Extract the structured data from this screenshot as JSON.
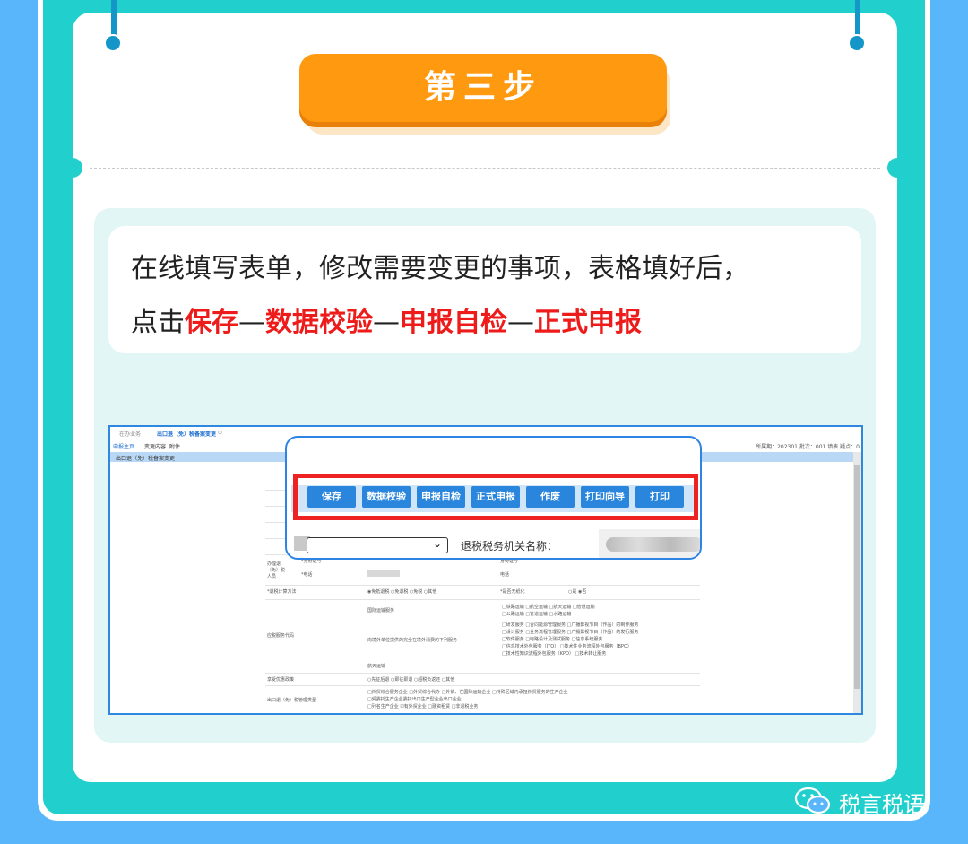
{
  "step_title": "第三步",
  "instruction": {
    "line1": "在线填写表单，修改需要变更的事项，表格填好后，",
    "prefix": "点击",
    "step1": "保存",
    "sep1": "—",
    "step2": "数据校验",
    "sep2": "—",
    "step3": "申报自检",
    "sep3": "—",
    "step4": "正式申报"
  },
  "screenshot": {
    "top_tabs": [
      "在办业务",
      "出口退（免）税备案变更",
      "⊙"
    ],
    "subtabs": [
      "申报主页",
      "变更内容",
      "附件"
    ],
    "header_info": "所属期：202301  批次：001  填表  疑点：0",
    "section_title": "出口退（免）税备案变更",
    "form_labels": {
      "agent": "办理退（免）税人员",
      "id_no": "*身份证号",
      "id_no2": "身份证号",
      "phone": "*电话",
      "phone2": "电话",
      "calc_method": "*退税计算方法",
      "calc_options": "◉免抵退税  ○免退税  ○免税  ○其他",
      "paperless": "*是否无纸化",
      "paperless_options": "○是  ◉否",
      "zero_rate_service": "应税服务代码",
      "international_transport": "国际运输服务",
      "foreign_service": "向境外单位提供的完全在境外消费的下列服务",
      "other_service": "航天运输",
      "tax_policy": "享受优惠政策",
      "tax_policy_options": "○先征后退  ○即征即退  ○超税负返还  ○其他",
      "mgmt_type": "出口退（免）税管理类型"
    },
    "service_options": [
      "□铁路运输  □航空运输  □航天运输  □管道运输",
      "□公路运输  □管道运输  □水路运输",
      "□研发服务  □合同能源管理服务  □广播影视节目（作品）的制作服务",
      "□设计服务  □业务流程管理服务  □广播影视节目（作品）的发行服务",
      "□软件服务  □电路设计及测试服务  □信息系统服务",
      "□信息技术外包服务（ITO）  □技术性业务流程外包服务（BPO）",
      "□技术性知识流程外包服务（KPO）  □技术转让服务"
    ],
    "mgmt_options": [
      "□外贸综合服务企业  □外贸综合代办  □外销、在国际运输企业  □特殊区域内承担外贸服务的生产企业",
      "□受委托生产企业委托出口生产型企业出口企业",
      "□列名生产企业  ☑有外贸企业  □融资租赁  □非退税业务"
    ]
  },
  "popup": {
    "buttons": [
      "保存",
      "数据校验",
      "申报自检",
      "正式申报",
      "作废",
      "打印向导",
      "打印"
    ],
    "authority_label": "退税税务机关名称："
  },
  "watermark": "税言税语"
}
